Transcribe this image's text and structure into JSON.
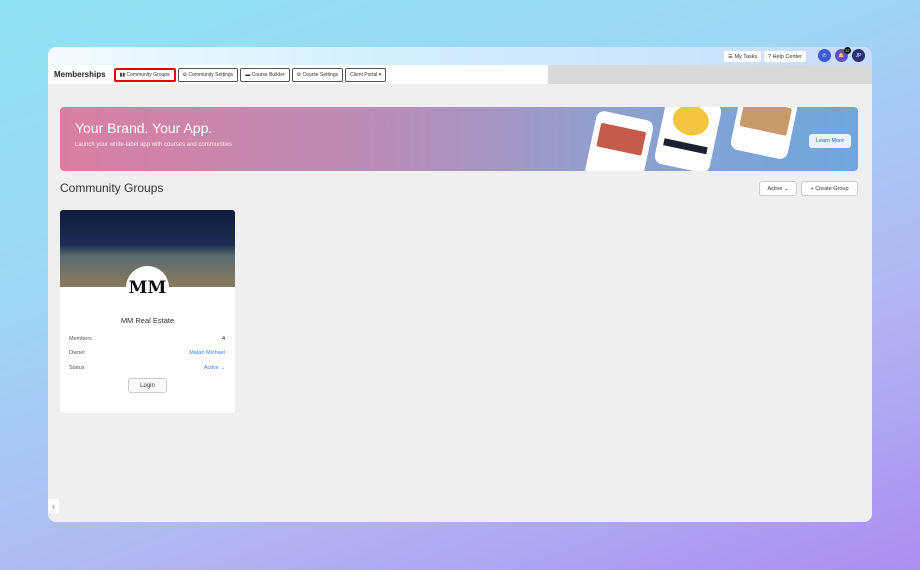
{
  "topbar": {
    "my_tasks": "My Tasks",
    "help_center": "Help Center",
    "notification_count": "37",
    "avatar_initials": "JP"
  },
  "nav": {
    "title": "Memberships",
    "tabs": [
      {
        "label": "Community Groups"
      },
      {
        "label": "Community Settings"
      },
      {
        "label": "Course Builder"
      },
      {
        "label": "Course Settings"
      },
      {
        "label": "Client Portal"
      }
    ]
  },
  "banner": {
    "title": "Your Brand. Your App.",
    "subtitle": "Launch your white-label app with courses and communities",
    "cta": "Learn More"
  },
  "section": {
    "title": "Community Groups",
    "filter": "Active",
    "create": "Create Group"
  },
  "card": {
    "logo_text": "MM",
    "name": "MM Real Estate",
    "members_label": "Members",
    "members": "4",
    "owner_label": "Owner",
    "owner": "Matan Michael",
    "status_label": "Status",
    "status": "Active",
    "login": "Login"
  },
  "colors": {
    "accent": "#3b82f6",
    "highlight": "#e00000"
  }
}
